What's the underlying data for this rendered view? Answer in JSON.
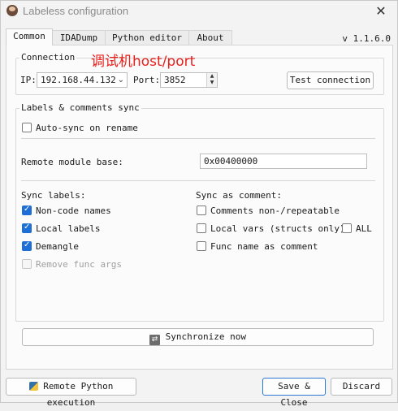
{
  "window": {
    "title": "Labeless configuration",
    "close_glyph": "✕"
  },
  "tabs": [
    {
      "label": "Common",
      "active": true
    },
    {
      "label": "IDADump",
      "active": false
    },
    {
      "label": "Python editor",
      "active": false
    },
    {
      "label": "About",
      "active": false
    }
  ],
  "version": "v 1.1.6.0",
  "annotation": "调试机host/port",
  "connection": {
    "title": "Connection",
    "ip_label": "IP:",
    "ip_value": "192.168.44.132",
    "port_label": "Port:",
    "port_value": "3852",
    "test_button": "Test connection"
  },
  "sync_group": {
    "title": "Labels & comments sync",
    "auto_sync": {
      "label": "Auto-sync on rename",
      "checked": false
    },
    "remote_base_label": "Remote module base:",
    "remote_base_value": "0x00400000",
    "sync_labels_title": "Sync labels:",
    "sync_labels": [
      {
        "label": "Non-code names",
        "checked": true,
        "enabled": true
      },
      {
        "label": "Local labels",
        "checked": true,
        "enabled": true
      },
      {
        "label": "Demangle",
        "checked": true,
        "enabled": true
      },
      {
        "label": "Remove func args",
        "checked": false,
        "enabled": false
      }
    ],
    "sync_comment_title": "Sync as comment:",
    "sync_comments": [
      {
        "label": "Comments non-/repeatable",
        "checked": false
      },
      {
        "label": "Local vars (structs only)",
        "checked": false
      },
      {
        "label": "Func name as comment",
        "checked": false
      }
    ],
    "all_checkbox": {
      "label": "ALL",
      "checked": false
    },
    "synchronize_button": "Synchronize now"
  },
  "footer": {
    "remote_python_button": "Remote Python execution",
    "save_button": "Save & Close",
    "discard_button": "Discard"
  }
}
